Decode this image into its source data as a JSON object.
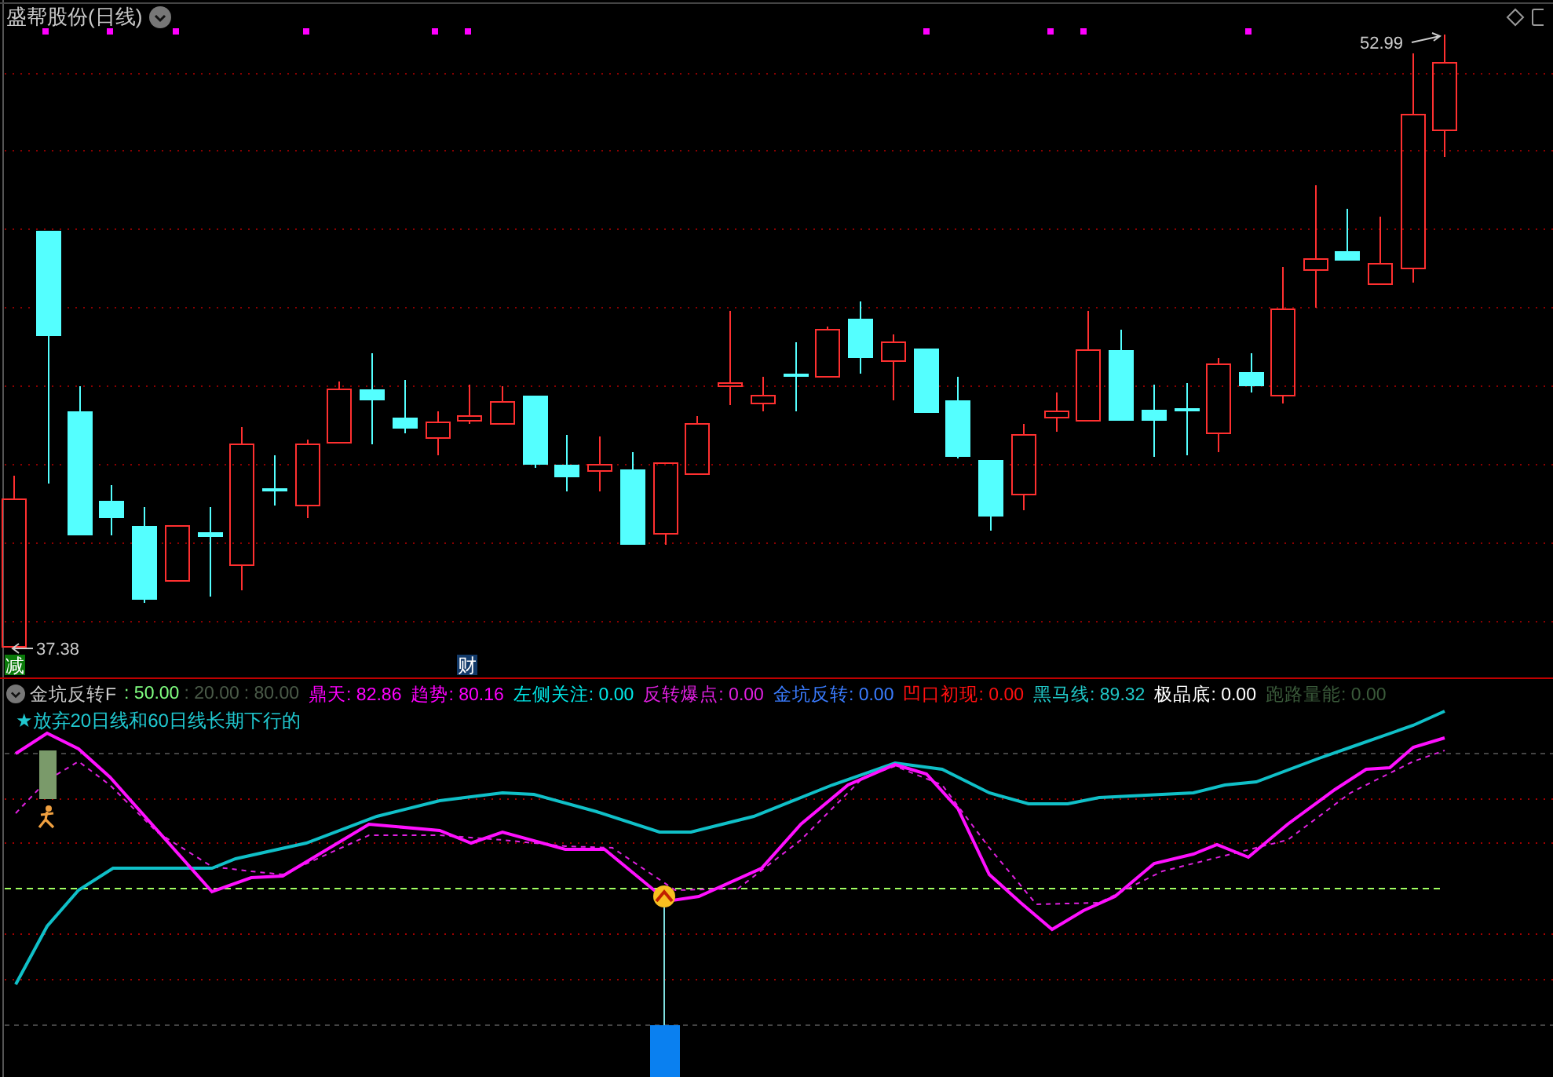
{
  "chart": {
    "title": "盛帮股份(日线)",
    "high_label": "52.99",
    "low_label": "37.38",
    "badges": [
      {
        "text": "减",
        "color": "#0a7a0a"
      },
      {
        "text": "财",
        "color": "#123a6a"
      }
    ]
  },
  "indicator": {
    "name": "金坑反转F",
    "params": [
      {
        "text": ": 50.00",
        "color": "#80ff80"
      },
      {
        "text": ": 20.00",
        "color": "#4a5a48"
      },
      {
        "text": ": 80.00",
        "color": "#4a5a48"
      }
    ],
    "readouts": [
      {
        "label": "鼎天:",
        "value": "82.86",
        "color": "#ff00ff"
      },
      {
        "label": "趋势:",
        "value": "80.16",
        "color": "#ff00ff"
      },
      {
        "label": "左侧关注:",
        "value": "0.00",
        "color": "#00e8e8"
      },
      {
        "label": "反转爆点:",
        "value": "0.00",
        "color": "#e020e0"
      },
      {
        "label": "金坑反转:",
        "value": "0.00",
        "color": "#3a7cff"
      },
      {
        "label": "凹口初现:",
        "value": "0.00",
        "color": "#ff1010"
      },
      {
        "label": "黑马线:",
        "value": "89.32",
        "color": "#20c8c8"
      },
      {
        "label": "极品底:",
        "value": "0.00",
        "color": "#ffffff"
      },
      {
        "label": "跑路量能:",
        "value": "0.00",
        "color": "#3a5a3a"
      }
    ],
    "note": "★放弃20日线和60日线长期下行的"
  }
}
